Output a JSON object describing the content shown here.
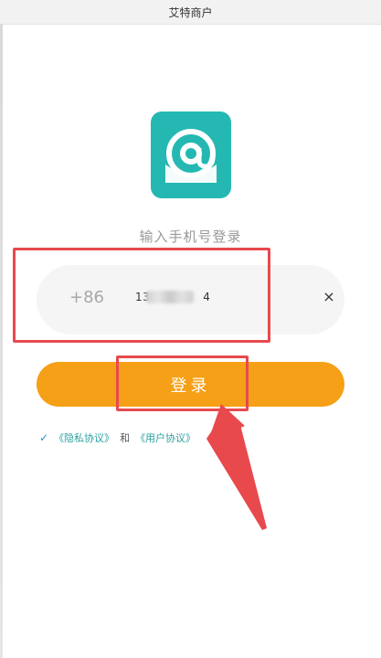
{
  "window": {
    "title": "艾特商户"
  },
  "login": {
    "prompt": "输入手机号登录",
    "country_code": "+86",
    "phone_prefix": "13",
    "phone_suffix": "4",
    "clear_icon": "×",
    "login_button": "登录"
  },
  "agreement": {
    "check_icon": "✓",
    "privacy_link": "《隐私协议》",
    "and_text": "和",
    "user_link": "《用户协议》"
  },
  "colors": {
    "brand_teal": "#25b8b3",
    "button_orange": "#f5a017",
    "annotation_red": "#e8494d"
  },
  "icons": {
    "logo": "at-sign-logo-icon",
    "clear": "close-icon",
    "check": "check-icon",
    "annotation": "red-arrow-icon"
  }
}
